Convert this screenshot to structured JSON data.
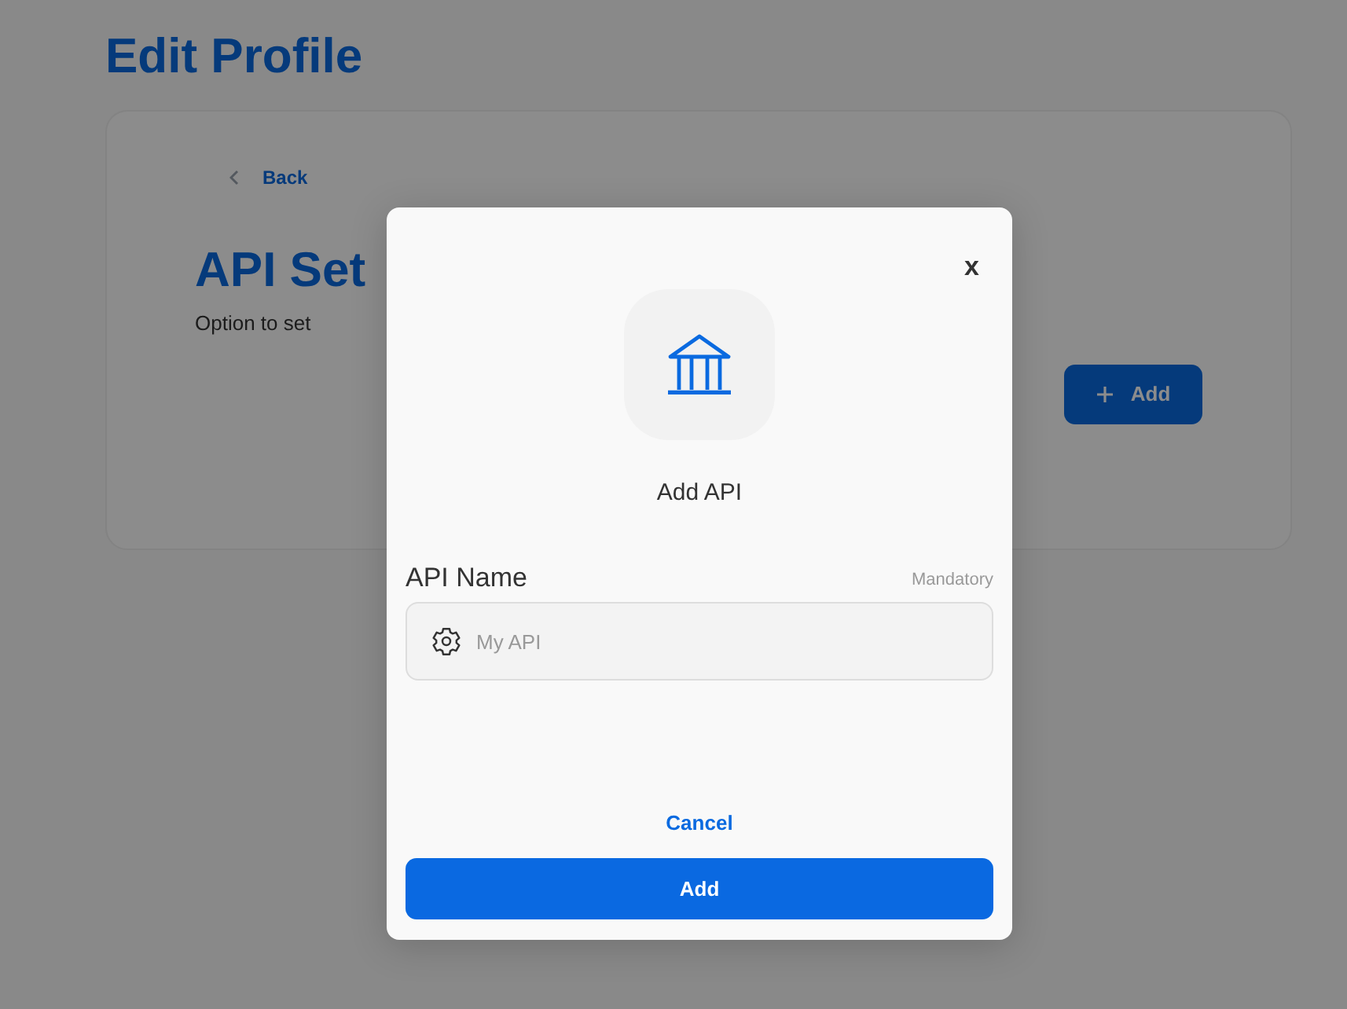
{
  "background_page": {
    "title": "Edit Profile",
    "back_link": "Back",
    "section_title": "API Set",
    "section_subtitle": "Option to set",
    "add_button": "Add"
  },
  "modal": {
    "close": "x",
    "heading": "Add API",
    "field": {
      "label": "API Name",
      "requirement": "Mandatory",
      "placeholder": "My API"
    },
    "cancel": "Cancel",
    "submit": "Add"
  }
}
